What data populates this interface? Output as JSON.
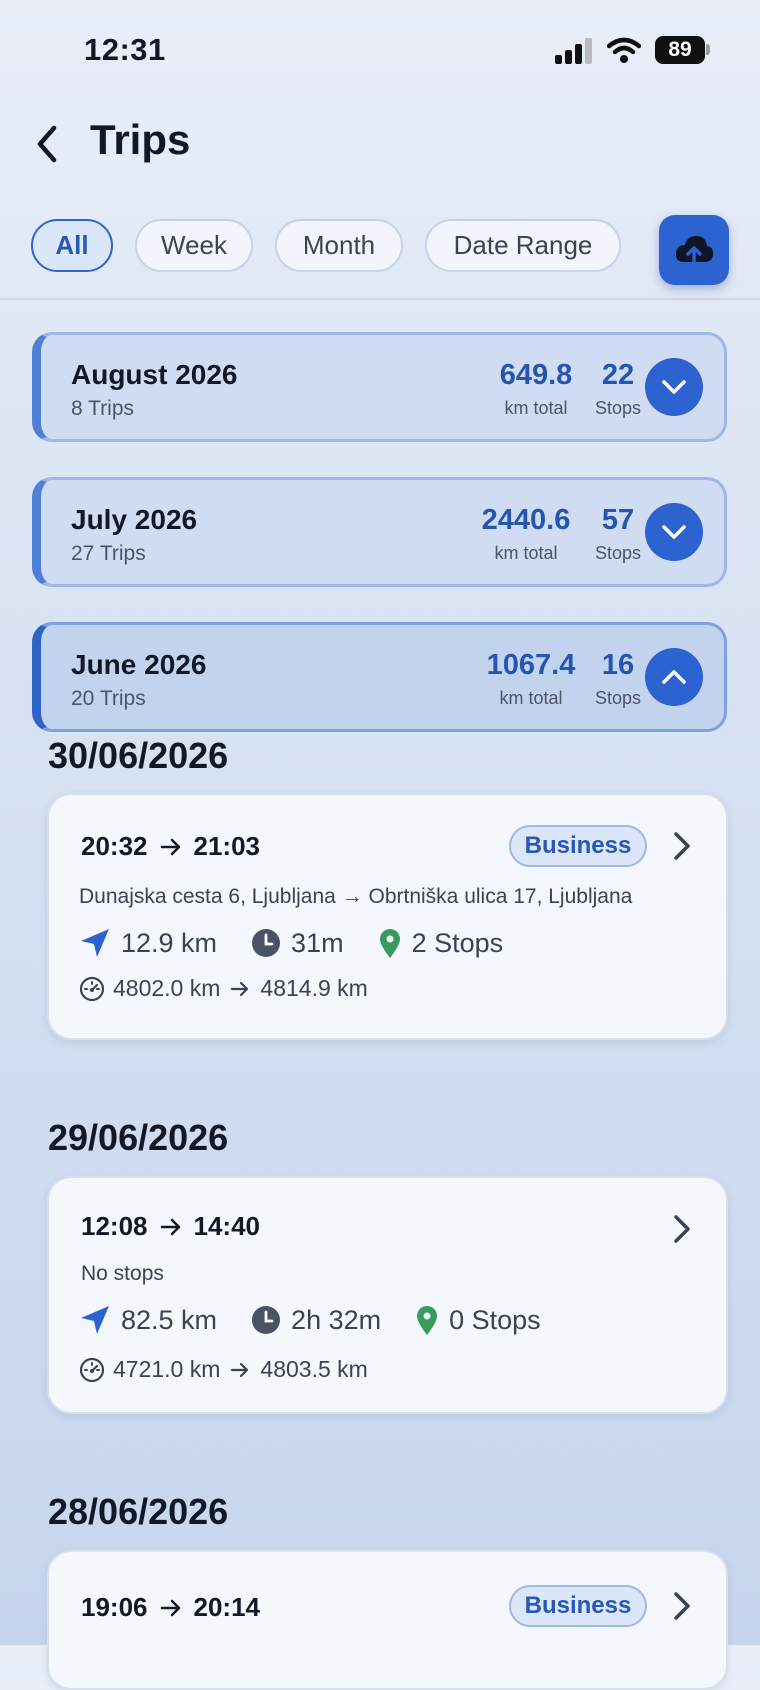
{
  "status_bar": {
    "time": "12:31",
    "battery": "89"
  },
  "header": {
    "title": "Trips"
  },
  "filters": [
    "All",
    "Week",
    "Month",
    "Date Range"
  ],
  "colors": {
    "accent": "#2c63d0",
    "stop_pin": "#3a9a5e",
    "clock": "#4a5366"
  },
  "months": [
    {
      "name": "August 2026",
      "trips": "8 Trips",
      "km": "649.8",
      "km_label": "km total",
      "stops": "22",
      "stops_label": "Stops"
    },
    {
      "name": "July 2026",
      "trips": "27 Trips",
      "km": "2440.6",
      "km_label": "km total",
      "stops": "57",
      "stops_label": "Stops"
    },
    {
      "name": "June 2026",
      "trips": "20 Trips",
      "km": "1067.4",
      "km_label": "km total",
      "stops": "16",
      "stops_label": "Stops"
    }
  ],
  "days": [
    {
      "date": "30/06/2026",
      "trip": {
        "start": "20:32",
        "end": "21:03",
        "badge": "Business",
        "route": "Dunajska cesta 6, Ljubljana → Obrtniška ulica 17, Ljubljana",
        "distance": "12.9 km",
        "duration": "31m",
        "stops": "2 Stops",
        "odo_start": "4802.0 km",
        "odo_end": "4814.9 km"
      }
    },
    {
      "date": "29/06/2026",
      "trip": {
        "start": "12:08",
        "end": "14:40",
        "route": "No stops",
        "distance": "82.5 km",
        "duration": "2h 32m",
        "stops": "0 Stops",
        "odo_start": "4721.0 km",
        "odo_end": "4803.5 km"
      }
    },
    {
      "date": "28/06/2026",
      "trip": {
        "start": "19:06",
        "end": "20:14",
        "badge": "Business"
      }
    }
  ]
}
